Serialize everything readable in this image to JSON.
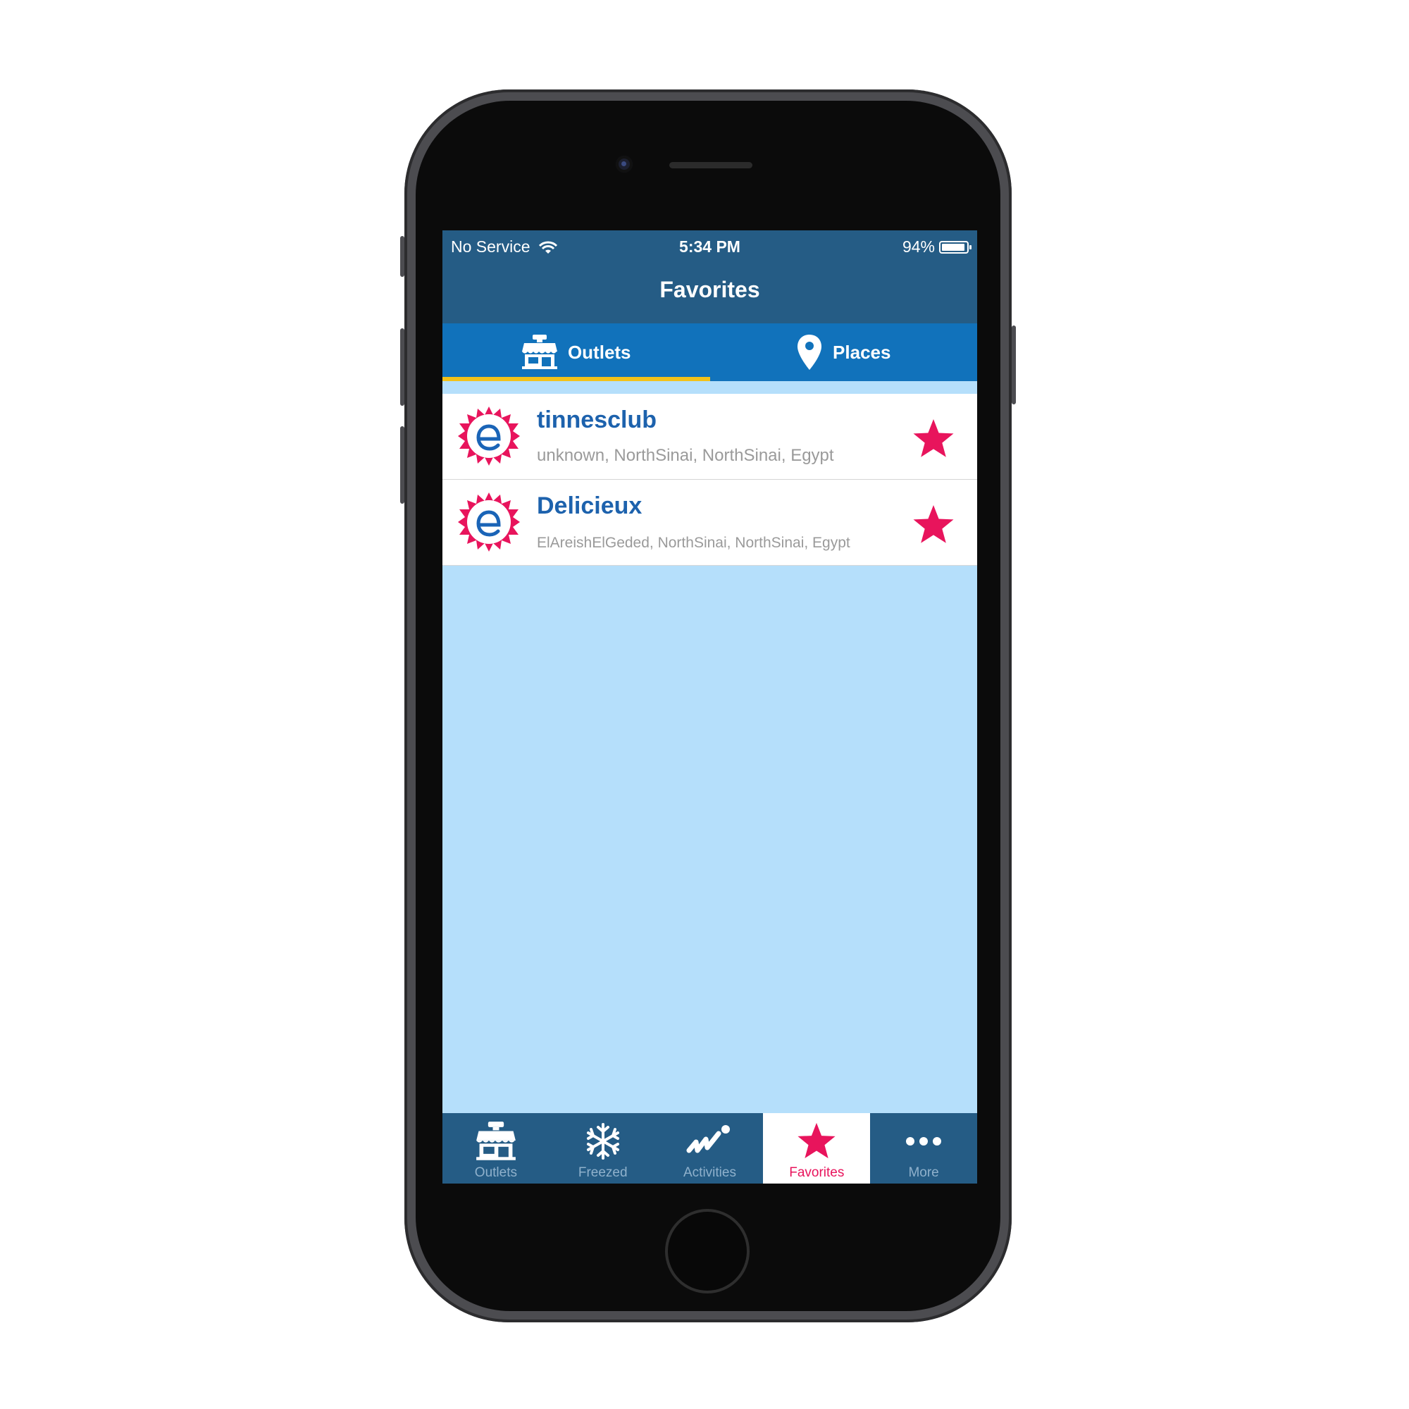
{
  "status_bar": {
    "carrier": "No Service",
    "time": "5:34 PM",
    "battery": "94%"
  },
  "nav": {
    "title": "Favorites"
  },
  "segments": [
    {
      "label": "Outlets",
      "icon": "store-icon",
      "active": true
    },
    {
      "label": "Places",
      "icon": "map-pin-icon",
      "active": false
    }
  ],
  "favorites": [
    {
      "name": "tinnesclub",
      "address": "unknown, NorthSinai, NorthSinai, Egypt",
      "logo": "e-logo-icon",
      "starred": true
    },
    {
      "name": "Delicieux",
      "address": "ElAreishElGeded, NorthSinai, NorthSinai, Egypt",
      "logo": "e-logo-icon",
      "starred": true
    }
  ],
  "tabbar": [
    {
      "label": "Outlets",
      "icon": "store-icon"
    },
    {
      "label": "Freezed",
      "icon": "snowflake-icon"
    },
    {
      "label": "Activities",
      "icon": "activity-chart-icon"
    },
    {
      "label": "Favorites",
      "icon": "star-icon",
      "active": true
    },
    {
      "label": "More",
      "icon": "more-dots-icon"
    }
  ],
  "colors": {
    "nav": "#255c85",
    "segment": "#1172bb",
    "indicator": "#f2c21a",
    "accent": "#e8145c",
    "title": "#1d62ad",
    "background": "#b5dffb"
  }
}
